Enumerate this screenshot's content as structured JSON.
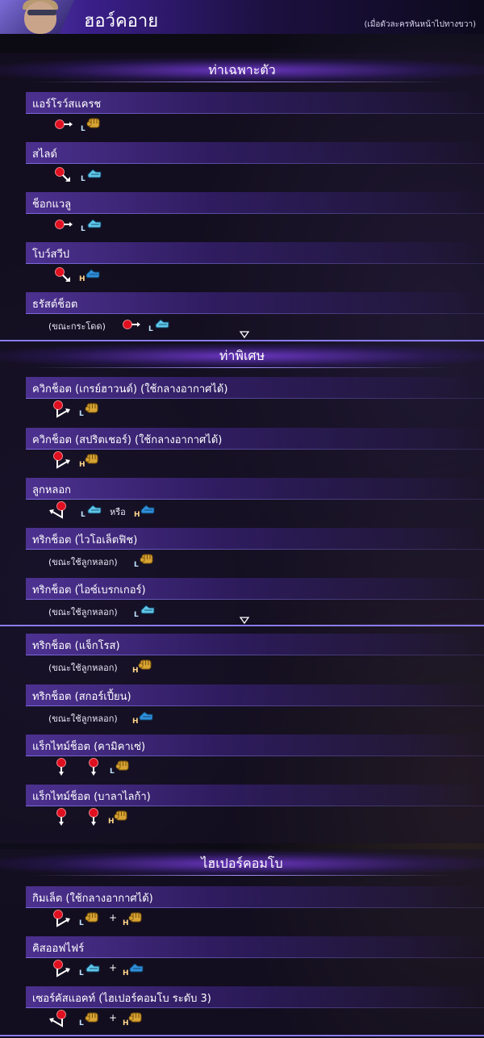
{
  "header": {
    "character_name": "ฮอว์คอาย",
    "note": "(เมื่อตัวละครหันหน้าไปทางขวา)"
  },
  "sections": [
    {
      "title": "ท่าเฉพาะตัว",
      "moves": [
        {
          "name": "แอร์โรว์สแครช",
          "condition": "",
          "inputs": [
            {
              "dir": "right"
            },
            {
              "btn": "punch",
              "lv": "L"
            }
          ]
        },
        {
          "name": "สไลด์",
          "condition": "",
          "inputs": [
            {
              "dir": "down-right"
            },
            {
              "btn": "kick",
              "lv": "L"
            }
          ]
        },
        {
          "name": "ช็อกแวลู",
          "condition": "",
          "inputs": [
            {
              "dir": "right"
            },
            {
              "btn": "kick",
              "lv": "L"
            }
          ]
        },
        {
          "name": "โบว์สวีป",
          "condition": "",
          "inputs": [
            {
              "dir": "down-right"
            },
            {
              "btn": "kick",
              "lv": "H"
            }
          ]
        },
        {
          "name": "ธรัสต์ช็อต",
          "condition": "(ขณะกระโดด)",
          "inputs": [
            {
              "dir": "right"
            },
            {
              "btn": "kick",
              "lv": "L"
            }
          ]
        }
      ]
    },
    {
      "title": "ท่าพิเศษ",
      "moves": [
        {
          "name": "ควิกช็อต (เกรย์ฮาวนด์) (ใช้กลางอากาศได้)",
          "condition": "",
          "inputs": [
            {
              "dir": "qcf"
            },
            {
              "btn": "punch",
              "lv": "L"
            }
          ]
        },
        {
          "name": "ควิกช็อต (สปริตเชอร์) (ใช้กลางอากาศได้)",
          "condition": "",
          "inputs": [
            {
              "dir": "qcf"
            },
            {
              "btn": "punch",
              "lv": "H"
            }
          ]
        },
        {
          "name": "ลูกหลอก",
          "condition": "",
          "or_label": "หรือ",
          "inputs": [
            {
              "dir": "qcb"
            },
            {
              "btn": "kick",
              "lv": "L"
            },
            {
              "btn": "kick",
              "lv": "H"
            }
          ]
        },
        {
          "name": "ทริกช็อต (ไวโอเล็ตฟิช)",
          "condition": "(ขณะใช้ลูกหลอก)",
          "inputs": [
            {
              "btn": "punch",
              "lv": "L"
            }
          ]
        },
        {
          "name": "ทริกช็อต (ไอซ์เบรกเกอร์)",
          "condition": "(ขณะใช้ลูกหลอก)",
          "inputs": [
            {
              "btn": "kick",
              "lv": "L"
            }
          ]
        },
        {
          "name": "ทริกช็อต (แจ็กโรส)",
          "condition": "(ขณะใช้ลูกหลอก)",
          "inputs": [
            {
              "btn": "punch",
              "lv": "H"
            }
          ]
        },
        {
          "name": "ทริกช็อต (สกอร์เปี้ยน)",
          "condition": "(ขณะใช้ลูกหลอก)",
          "inputs": [
            {
              "btn": "kick",
              "lv": "H"
            }
          ]
        },
        {
          "name": "แร็กไทม์ช็อต (คามิคาเซ่)",
          "condition": "",
          "inputs": [
            {
              "dir": "down"
            },
            {
              "dir": "down"
            },
            {
              "btn": "punch",
              "lv": "L"
            }
          ]
        },
        {
          "name": "แร็กไทม์ช็อต (บาลาไลก้า)",
          "condition": "",
          "inputs": [
            {
              "dir": "down"
            },
            {
              "dir": "down"
            },
            {
              "btn": "punch",
              "lv": "H"
            }
          ]
        }
      ]
    },
    {
      "title": "ไฮเปอร์คอมโบ",
      "moves": [
        {
          "name": "กิมเล็ต (ใช้กลางอากาศได้)",
          "condition": "",
          "plus": "+",
          "inputs": [
            {
              "dir": "qcf"
            },
            {
              "btn": "punch",
              "lv": "L"
            },
            {
              "btn": "punch",
              "lv": "H"
            }
          ]
        },
        {
          "name": "คิสออฟไฟร์",
          "condition": "",
          "plus": "+",
          "inputs": [
            {
              "dir": "qcf"
            },
            {
              "btn": "kick",
              "lv": "L"
            },
            {
              "btn": "kick",
              "lv": "H"
            }
          ]
        },
        {
          "name": "เซอร์คัสแอคท์ (ไฮเปอร์คอมโบ ระดับ 3)",
          "condition": "",
          "plus": "+",
          "inputs": [
            {
              "dir": "qcb"
            },
            {
              "btn": "punch",
              "lv": "L"
            },
            {
              "btn": "punch",
              "lv": "H"
            }
          ]
        }
      ]
    }
  ],
  "colors": {
    "accent": "#8a7cff",
    "band": "#5f3cb4",
    "dir_ball": "#e01020",
    "punch": "#d6a334",
    "kick_light": "#5fc7e8",
    "kick_heavy": "#2f8fdc"
  }
}
